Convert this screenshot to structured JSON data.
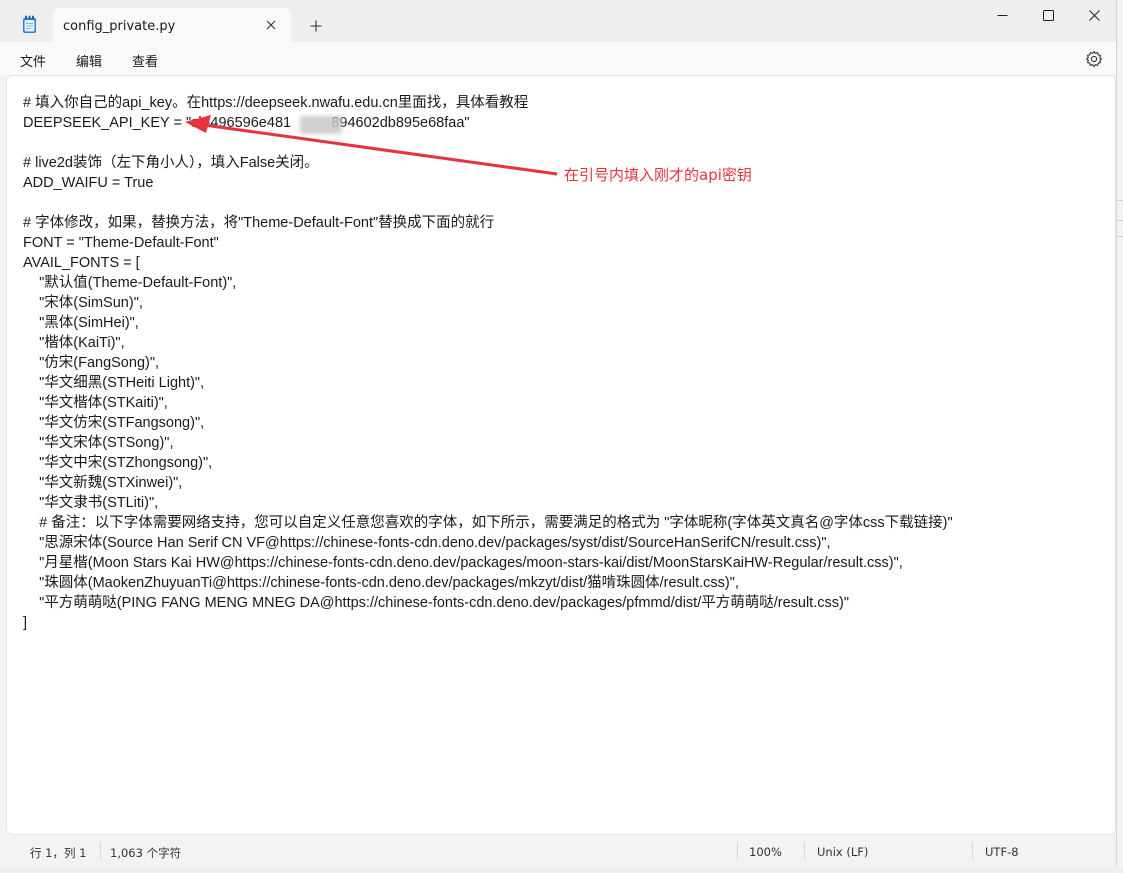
{
  "window": {
    "tab_title": "config_private.py",
    "new_tab_glyph": "+",
    "controls": [
      "minimize-icon",
      "maximize-icon",
      "close-icon"
    ]
  },
  "menu": {
    "file": "文件",
    "edit": "编辑",
    "view": "查看",
    "settings_icon": "gear-icon"
  },
  "editor": {
    "lines": [
      "# 填入你自己的api_key。在https://deepseek.nwafu.edu.cn里面找，具体看教程",
      "DEEPSEEK_API_KEY = \"sk-496596e481          894602db895e68faa\"",
      "",
      "# live2d装饰（左下角小人），填入False关闭。",
      "ADD_WAIFU = True",
      "",
      "# 字体修改，如果，替换方法，将\"Theme-Default-Font\"替换成下面的就行",
      "FONT = \"Theme-Default-Font\"",
      "AVAIL_FONTS = [",
      "    \"默认值(Theme-Default-Font)\",",
      "    \"宋体(SimSun)\",",
      "    \"黑体(SimHei)\",",
      "    \"楷体(KaiTi)\",",
      "    \"仿宋(FangSong)\",",
      "    \"华文细黑(STHeiti Light)\",",
      "    \"华文楷体(STKaiti)\",",
      "    \"华文仿宋(STFangsong)\",",
      "    \"华文宋体(STSong)\",",
      "    \"华文中宋(STZhongsong)\",",
      "    \"华文新魏(STXinwei)\",",
      "    \"华文隶书(STLiti)\",",
      "    # 备注：以下字体需要网络支持，您可以自定义任意您喜欢的字体，如下所示，需要满足的格式为 \"字体昵称(字体英文真名@字体css下载链接)\"",
      "    \"思源宋体(Source Han Serif CN VF@https://chinese-fonts-cdn.deno.dev/packages/syst/dist/SourceHanSerifCN/result.css)\",",
      "    \"月星楷(Moon Stars Kai HW@https://chinese-fonts-cdn.deno.dev/packages/moon-stars-kai/dist/MoonStarsKaiHW-Regular/result.css)\",",
      "    \"珠圆体(MaokenZhuyuanTi@https://chinese-fonts-cdn.deno.dev/packages/mkzyt/dist/猫啃珠圆体/result.css)\",",
      "    \"平方萌萌哒(PING FANG MENG MNEG DA@https://chinese-fonts-cdn.deno.dev/packages/pfmmd/dist/平方萌萌哒/result.css)\"",
      "]"
    ],
    "annotation_text": "在引号内填入刚才的api密钥",
    "annotation_color": "#e8323c"
  },
  "status": {
    "position": "行 1，列 1",
    "char_count": "1,063 个字符",
    "zoom": "100%",
    "line_ending": "Unix (LF)",
    "encoding": "UTF-8"
  }
}
